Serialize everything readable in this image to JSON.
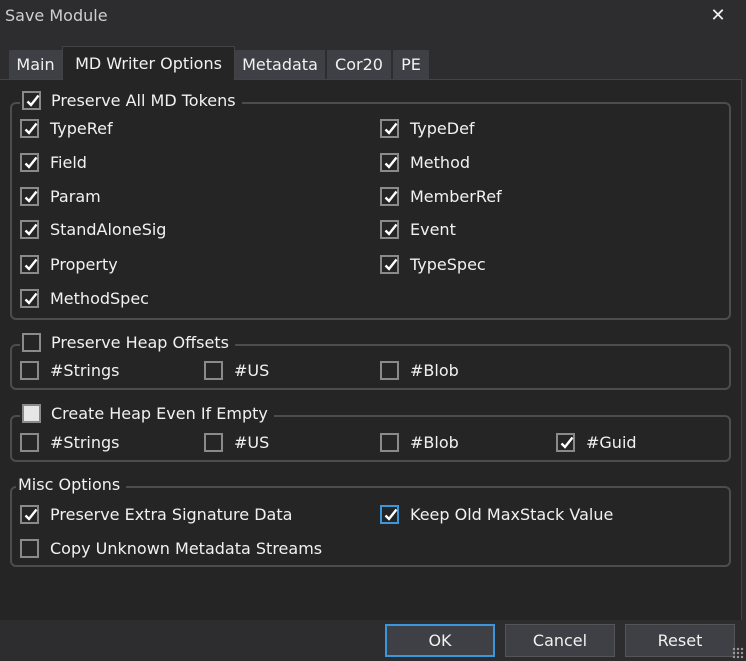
{
  "window": {
    "title": "Save Module",
    "close_label": "✕"
  },
  "tabs": [
    {
      "label": "Main",
      "active": false
    },
    {
      "label": "MD Writer Options",
      "active": true
    },
    {
      "label": "Metadata",
      "active": false
    },
    {
      "label": "Cor20",
      "active": false
    },
    {
      "label": "PE",
      "active": false
    }
  ],
  "groups": {
    "preserve_tokens": {
      "label": "Preserve All MD Tokens",
      "checked": true,
      "items": [
        {
          "label": "TypeRef",
          "checked": true
        },
        {
          "label": "TypeDef",
          "checked": true
        },
        {
          "label": "Field",
          "checked": true
        },
        {
          "label": "Method",
          "checked": true
        },
        {
          "label": "Param",
          "checked": true
        },
        {
          "label": "MemberRef",
          "checked": true
        },
        {
          "label": "StandAloneSig",
          "checked": true
        },
        {
          "label": "Event",
          "checked": true
        },
        {
          "label": "Property",
          "checked": true
        },
        {
          "label": "TypeSpec",
          "checked": true
        },
        {
          "label": "MethodSpec",
          "checked": true
        }
      ]
    },
    "heap_offsets": {
      "label": "Preserve Heap Offsets",
      "checked": false,
      "items": [
        {
          "label": "#Strings",
          "checked": false
        },
        {
          "label": "#US",
          "checked": false
        },
        {
          "label": "#Blob",
          "checked": false
        }
      ]
    },
    "create_heap": {
      "label": "Create Heap Even If Empty",
      "checked": "indeterminate",
      "items": [
        {
          "label": "#Strings",
          "checked": false
        },
        {
          "label": "#US",
          "checked": false
        },
        {
          "label": "#Blob",
          "checked": false
        },
        {
          "label": "#Guid",
          "checked": true
        }
      ]
    },
    "misc": {
      "label": "Misc Options",
      "items": [
        {
          "label": "Preserve Extra Signature Data",
          "checked": true
        },
        {
          "label": "Keep Old MaxStack Value",
          "checked": true,
          "focused": true
        },
        {
          "label": "Copy Unknown Metadata Streams",
          "checked": false
        }
      ]
    }
  },
  "buttons": {
    "ok": "OK",
    "cancel": "Cancel",
    "reset": "Reset"
  },
  "colors": {
    "background": "#2d2d30",
    "panel": "#252526",
    "accent": "#3a96dd",
    "group_border": "#4d4d50"
  }
}
